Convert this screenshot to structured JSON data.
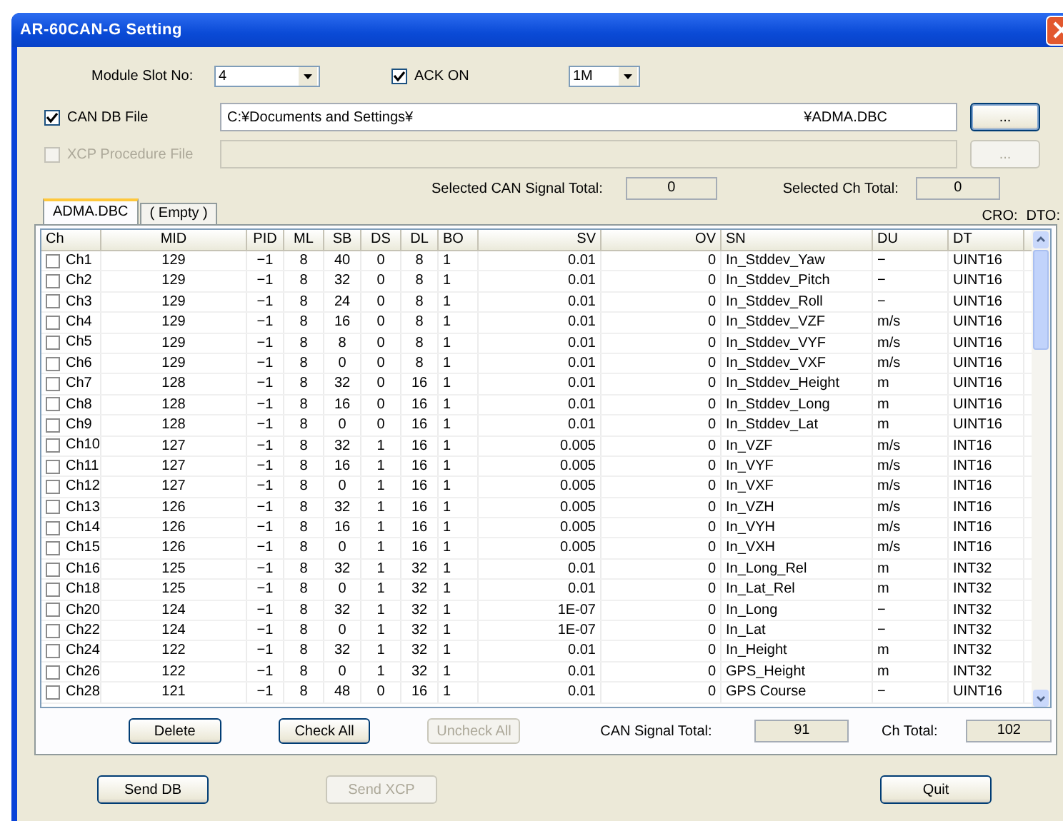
{
  "window": {
    "title": "AR-60CAN-G Setting"
  },
  "module_slot": {
    "label": "Module Slot No:",
    "value": "4"
  },
  "ack": {
    "label": "ACK ON",
    "checked": true
  },
  "baud": {
    "value": "1M"
  },
  "can_db_file": {
    "label": "CAN DB File",
    "checked": true,
    "disabled": false,
    "path_start": "C:¥Documents and Settings¥",
    "path_end": "¥ADMA.DBC",
    "browse": "..."
  },
  "xcp_file": {
    "label": "XCP Procedure File",
    "checked": false,
    "disabled": true,
    "browse": "..."
  },
  "selected_signal_total": {
    "label": "Selected CAN Signal Total:",
    "value": "0"
  },
  "selected_ch_total": {
    "label": "Selected Ch Total:",
    "value": "0"
  },
  "tabs": [
    {
      "label": "ADMA.DBC",
      "selected": true
    },
    {
      "label": "( Empty )",
      "selected": false
    }
  ],
  "cro_label": "CRO:",
  "dto_label": "DTO:",
  "table": {
    "columns": [
      "Ch",
      "MID",
      "PID",
      "ML",
      "SB",
      "DS",
      "DL",
      "BO",
      "SV",
      "OV",
      "SN",
      "DU",
      "DT"
    ],
    "rows": [
      {
        "checked": false,
        "cells": [
          "Ch1",
          "129",
          "−1",
          "8",
          "40",
          "0",
          "8",
          "1",
          "0.01",
          "0",
          "In_Stddev_Yaw",
          "−",
          "UINT16"
        ]
      },
      {
        "checked": false,
        "cells": [
          "Ch2",
          "129",
          "−1",
          "8",
          "32",
          "0",
          "8",
          "1",
          "0.01",
          "0",
          "In_Stddev_Pitch",
          "−",
          "UINT16"
        ]
      },
      {
        "checked": false,
        "cells": [
          "Ch3",
          "129",
          "−1",
          "8",
          "24",
          "0",
          "8",
          "1",
          "0.01",
          "0",
          "In_Stddev_Roll",
          "−",
          "UINT16"
        ]
      },
      {
        "checked": false,
        "cells": [
          "Ch4",
          "129",
          "−1",
          "8",
          "16",
          "0",
          "8",
          "1",
          "0.01",
          "0",
          "In_Stddev_VZF",
          "m/s",
          "UINT16"
        ]
      },
      {
        "checked": false,
        "cells": [
          "Ch5",
          "129",
          "−1",
          "8",
          "8",
          "0",
          "8",
          "1",
          "0.01",
          "0",
          "In_Stddev_VYF",
          "m/s",
          "UINT16"
        ]
      },
      {
        "checked": false,
        "cells": [
          "Ch6",
          "129",
          "−1",
          "8",
          "0",
          "0",
          "8",
          "1",
          "0.01",
          "0",
          "In_Stddev_VXF",
          "m/s",
          "UINT16"
        ]
      },
      {
        "checked": false,
        "cells": [
          "Ch7",
          "128",
          "−1",
          "8",
          "32",
          "0",
          "16",
          "1",
          "0.01",
          "0",
          "In_Stddev_Height",
          "m",
          "UINT16"
        ]
      },
      {
        "checked": false,
        "cells": [
          "Ch8",
          "128",
          "−1",
          "8",
          "16",
          "0",
          "16",
          "1",
          "0.01",
          "0",
          "In_Stddev_Long",
          "m",
          "UINT16"
        ]
      },
      {
        "checked": false,
        "cells": [
          "Ch9",
          "128",
          "−1",
          "8",
          "0",
          "0",
          "16",
          "1",
          "0.01",
          "0",
          "In_Stddev_Lat",
          "m",
          "UINT16"
        ]
      },
      {
        "checked": false,
        "cells": [
          "Ch10",
          "127",
          "−1",
          "8",
          "32",
          "1",
          "16",
          "1",
          "0.005",
          "0",
          "In_VZF",
          "m/s",
          "INT16"
        ]
      },
      {
        "checked": false,
        "cells": [
          "Ch11",
          "127",
          "−1",
          "8",
          "16",
          "1",
          "16",
          "1",
          "0.005",
          "0",
          "In_VYF",
          "m/s",
          "INT16"
        ]
      },
      {
        "checked": false,
        "cells": [
          "Ch12",
          "127",
          "−1",
          "8",
          "0",
          "1",
          "16",
          "1",
          "0.005",
          "0",
          "In_VXF",
          "m/s",
          "INT16"
        ]
      },
      {
        "checked": false,
        "cells": [
          "Ch13",
          "126",
          "−1",
          "8",
          "32",
          "1",
          "16",
          "1",
          "0.005",
          "0",
          "In_VZH",
          "m/s",
          "INT16"
        ]
      },
      {
        "checked": false,
        "cells": [
          "Ch14",
          "126",
          "−1",
          "8",
          "16",
          "1",
          "16",
          "1",
          "0.005",
          "0",
          "In_VYH",
          "m/s",
          "INT16"
        ]
      },
      {
        "checked": false,
        "cells": [
          "Ch15",
          "126",
          "−1",
          "8",
          "0",
          "1",
          "16",
          "1",
          "0.005",
          "0",
          "In_VXH",
          "m/s",
          "INT16"
        ]
      },
      {
        "checked": false,
        "cells": [
          "Ch16",
          "125",
          "−1",
          "8",
          "32",
          "1",
          "32",
          "1",
          "0.01",
          "0",
          "In_Long_Rel",
          "m",
          "INT32"
        ]
      },
      {
        "checked": false,
        "cells": [
          "Ch18",
          "125",
          "−1",
          "8",
          "0",
          "1",
          "32",
          "1",
          "0.01",
          "0",
          "In_Lat_Rel",
          "m",
          "INT32"
        ]
      },
      {
        "checked": false,
        "cells": [
          "Ch20",
          "124",
          "−1",
          "8",
          "32",
          "1",
          "32",
          "1",
          "1E-07",
          "0",
          "In_Long",
          "−",
          "INT32"
        ]
      },
      {
        "checked": false,
        "cells": [
          "Ch22",
          "124",
          "−1",
          "8",
          "0",
          "1",
          "32",
          "1",
          "1E-07",
          "0",
          "In_Lat",
          "−",
          "INT32"
        ]
      },
      {
        "checked": false,
        "cells": [
          "Ch24",
          "122",
          "−1",
          "8",
          "32",
          "1",
          "32",
          "1",
          "0.01",
          "0",
          "In_Height",
          "m",
          "INT32"
        ]
      },
      {
        "checked": false,
        "cells": [
          "Ch26",
          "122",
          "−1",
          "8",
          "0",
          "1",
          "32",
          "1",
          "0.01",
          "0",
          "GPS_Height",
          "m",
          "INT32"
        ]
      },
      {
        "checked": false,
        "cells": [
          "Ch28",
          "121",
          "−1",
          "8",
          "48",
          "0",
          "16",
          "1",
          "0.01",
          "0",
          "GPS Course",
          "−",
          "UINT16"
        ]
      }
    ]
  },
  "table_buttons": [
    {
      "label": "Delete",
      "disabled": false
    },
    {
      "label": "Check All",
      "disabled": false
    },
    {
      "label": "Uncheck All",
      "disabled": true
    }
  ],
  "can_signal_total": {
    "label": "CAN Signal Total:",
    "value": "91"
  },
  "ch_total": {
    "label": "Ch Total:",
    "value": "102"
  },
  "bottom_buttons": [
    {
      "label": "Send DB",
      "disabled": false
    },
    {
      "label": "Send XCP",
      "disabled": true
    },
    {
      "label": "Quit",
      "disabled": false
    }
  ]
}
